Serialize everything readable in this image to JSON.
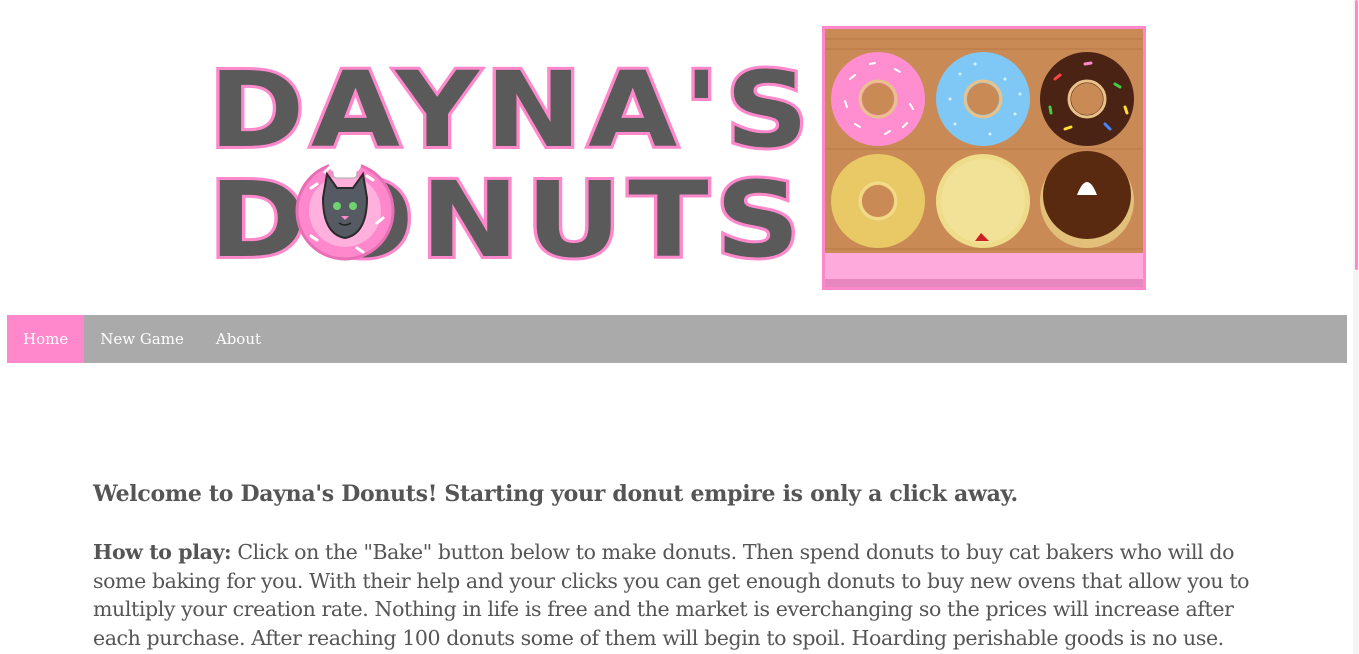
{
  "header": {
    "logo_line1": "DAYNA'S",
    "logo_line2": "DONUTS",
    "logo_alt": "Dayna's Donuts",
    "donut_box_alt": "box of six donuts"
  },
  "nav": {
    "items": [
      {
        "label": "Home",
        "active": true
      },
      {
        "label": "New Game",
        "active": false
      },
      {
        "label": "About",
        "active": false
      }
    ]
  },
  "main": {
    "welcome": "Welcome to Dayna's Donuts! Starting your donut empire is only a click away.",
    "howto_label": "How to play:",
    "howto_text": " Click on the \"Bake\" button below to make donuts. Then spend donuts to buy cat bakers who will do some baking for you. With their help and your clicks you can get enough donuts to buy new ovens that allow you to multiply your creation rate. Nothing in life is free and the market is everchanging so the prices will increase after each purchase. After reaching 100 donuts some of them will begin to spoil. Hoarding perishable goods is no use."
  },
  "colors": {
    "accent": "#ff88cc",
    "nav_bg": "#aaaaaa",
    "text": "#555555",
    "logo_fill": "#5a5a5a"
  }
}
